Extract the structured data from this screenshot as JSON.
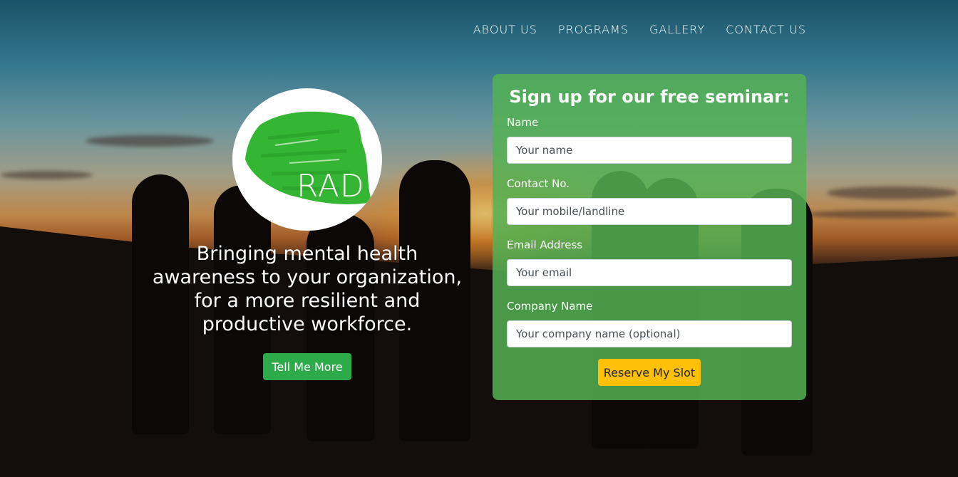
{
  "nav": {
    "items": [
      {
        "label": "ABOUT US"
      },
      {
        "label": "PROGRAMS"
      },
      {
        "label": "GALLERY"
      },
      {
        "label": "CONTACT US"
      }
    ]
  },
  "brand": {
    "logo_text": "RAD",
    "logo_color": "#34b634"
  },
  "hero": {
    "tagline_lines": [
      "Bringing mental health",
      "awareness to your organization,",
      "for a more resilient and",
      "productive workforce."
    ],
    "cta_label": "Tell Me More",
    "cta_color": "#2daa4a"
  },
  "form": {
    "title": "Sign up for our free seminar:",
    "fields": [
      {
        "label": "Name",
        "placeholder": "Your name",
        "value": ""
      },
      {
        "label": "Contact No.",
        "placeholder": "Your mobile/landline",
        "value": ""
      },
      {
        "label": "Email Address",
        "placeholder": "Your email",
        "value": ""
      },
      {
        "label": "Company Name",
        "placeholder": "Your company name (optional)",
        "value": ""
      }
    ],
    "submit_label": "Reserve My Slot",
    "submit_color": "#ffc107",
    "panel_color": "#54b254"
  }
}
